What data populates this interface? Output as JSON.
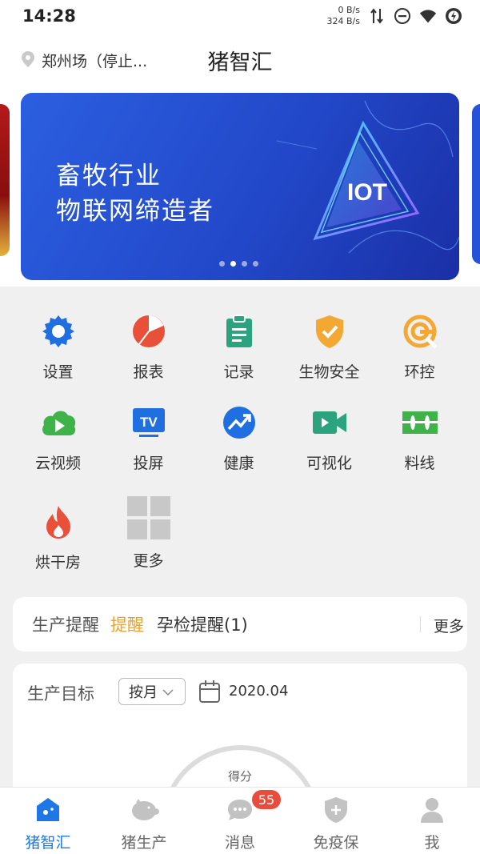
{
  "status_bar": {
    "time": "14:28",
    "upload_speed": "0 B/s",
    "download_speed": "324 B/s",
    "icons": [
      "data-transfer-icon",
      "do-not-disturb-icon",
      "wifi-icon",
      "battery-charging-icon"
    ]
  },
  "header": {
    "location": "郑州场（停止...",
    "title": "猪智汇",
    "location_icon": "location-pin-icon"
  },
  "banner": {
    "line1": "畜牧行业",
    "line2": "物联网缔造者",
    "art_text": "IOT",
    "page_count": 4,
    "active_page": 1
  },
  "menu": {
    "items": [
      {
        "label": "设置",
        "icon": "settings-gear-icon",
        "color": "#1f6fe0"
      },
      {
        "label": "报表",
        "icon": "pie-chart-icon",
        "color": "#e8503a"
      },
      {
        "label": "记录",
        "icon": "clipboard-icon",
        "color": "#2ba37e"
      },
      {
        "label": "生物安全",
        "icon": "shield-check-icon",
        "color": "#f2a833"
      },
      {
        "label": "环控",
        "icon": "environment-control-icon",
        "color": "#f2a833"
      },
      {
        "label": "云视频",
        "icon": "cloud-video-icon",
        "color": "#3fb24a"
      },
      {
        "label": "投屏",
        "icon": "tv-cast-icon",
        "color": "#1f6fe0"
      },
      {
        "label": "健康",
        "icon": "health-trend-icon",
        "color": "#1f6fe0"
      },
      {
        "label": "可视化",
        "icon": "video-camera-icon",
        "color": "#2ba37e"
      },
      {
        "label": "料线",
        "icon": "feed-line-icon",
        "color": "#3fb24a"
      },
      {
        "label": "烘干房",
        "icon": "flame-icon",
        "color": "#e8503a"
      },
      {
        "label": "更多",
        "icon": "more-grid-icon",
        "color": "#c8c8c8"
      }
    ]
  },
  "reminder": {
    "title": "生产提醒",
    "tag": "提醒",
    "pregnancy_check": "孕检提醒(1)",
    "more": "更多"
  },
  "production_target": {
    "title": "生产目标",
    "period": "按月",
    "date": "2020.04",
    "score_label": "得分"
  },
  "bottom_nav": {
    "items": [
      {
        "label": "猪智汇",
        "icon": "home-icon",
        "active": true
      },
      {
        "label": "猪生产",
        "icon": "pig-icon",
        "active": false
      },
      {
        "label": "消息",
        "icon": "message-icon",
        "active": false,
        "badge": "55"
      },
      {
        "label": "免疫保",
        "icon": "shield-plus-icon",
        "active": false
      },
      {
        "label": "我",
        "icon": "user-profile-icon",
        "active": false
      }
    ]
  },
  "colors": {
    "accent": "#1f77e6",
    "tag": "#e7a42a",
    "badge": "#e84c3d",
    "banner": "#2453d8"
  }
}
